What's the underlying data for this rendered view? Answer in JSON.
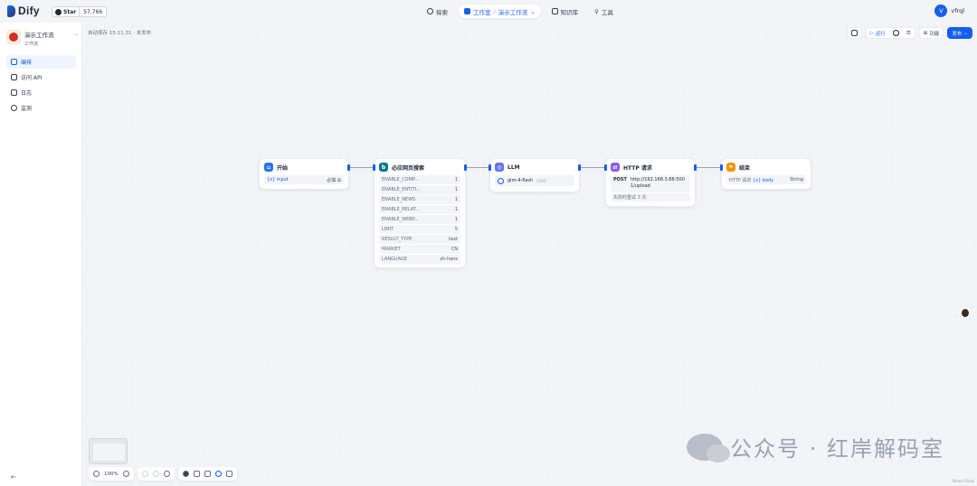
{
  "header": {
    "logo_text": "Dify",
    "star_label": "Star",
    "star_count": "57,766",
    "nav": [
      {
        "label": "探索",
        "icon": "compass-icon"
      },
      {
        "label": "工作室",
        "icon": "studio-icon"
      },
      {
        "label": "演示工作流",
        "icon": "chevron-down-icon"
      },
      {
        "label": "知识库",
        "icon": "book-icon"
      },
      {
        "label": "工具",
        "icon": "tool-icon"
      }
    ],
    "user_initial": "V",
    "user_name": "vfrql"
  },
  "sidebar": {
    "app_name": "演示工作流",
    "app_type": "工作流",
    "items": [
      {
        "label": "编排",
        "icon": "layout-icon",
        "active": true
      },
      {
        "label": "访问 API",
        "icon": "api-icon",
        "active": false
      },
      {
        "label": "日志",
        "icon": "log-icon",
        "active": false
      },
      {
        "label": "监测",
        "icon": "monitor-icon",
        "active": false
      }
    ]
  },
  "canvas": {
    "autosave_text": "自动保存 15:11:31 · 未发布",
    "toolbar": {
      "run_label": "运行",
      "features_label": "功能",
      "publish_label": "发布"
    },
    "nodes": {
      "start": {
        "title": "开始",
        "rows": [
          {
            "key": "{x} input",
            "value": "必填 ⊞"
          }
        ]
      },
      "bing": {
        "title": "必应网页搜索",
        "rows": [
          {
            "key": "ENABLE_COMP...",
            "value": "1"
          },
          {
            "key": "ENABLE_ENTITI...",
            "value": "1"
          },
          {
            "key": "ENABLE_NEWS",
            "value": "1"
          },
          {
            "key": "ENABLE_RELAT...",
            "value": "1"
          },
          {
            "key": "ENABLE_WEBP...",
            "value": "1"
          },
          {
            "key": "LIMIT",
            "value": "5"
          },
          {
            "key": "RESULT_TYPE",
            "value": "text"
          },
          {
            "key": "MARKET",
            "value": "CN"
          },
          {
            "key": "LANGUAGE",
            "value": "zh-hans"
          }
        ]
      },
      "llm": {
        "title": "LLM",
        "model": "glm-4-flash",
        "mode": "CHAT"
      },
      "http": {
        "title": "HTTP 请求",
        "method": "POST",
        "url": "http://192.168.3.86:5001/upload",
        "retry": "失败时重试 3 次"
      },
      "end": {
        "title": "结束",
        "rows": [
          {
            "source": "HTTP 请求",
            "var": "{x} body",
            "type": "String"
          }
        ]
      }
    },
    "zoom": "100%",
    "watermark": "公众号 · 红岸解码室",
    "attribution": "React Flow"
  },
  "colors": {
    "accent": "#155eef",
    "start_icon": "#2970ff",
    "llm_icon": "#6172f3",
    "http_icon": "#875bf7",
    "end_icon": "#f79009"
  }
}
